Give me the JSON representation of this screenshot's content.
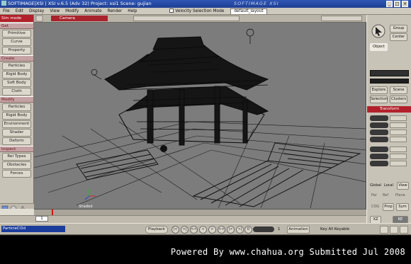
{
  "window": {
    "title": "SOFTIMAGE|XSI | XSI v.6.5 (Adv 32) Project: xsi1   Scene: gujian",
    "watermark": "SOFTIMAGE XSI",
    "controls": [
      "_",
      "□",
      "×"
    ]
  },
  "menubar": {
    "items": [
      "File",
      "Edit",
      "Display",
      "View",
      "Modify",
      "Animate",
      "Render",
      "Help"
    ],
    "checkbox_label": "Velocity Selection Mode",
    "dropdown_value": "default_layout"
  },
  "toolbar": {
    "title": "Sim mode",
    "sections": [
      {
        "label": "Get",
        "buttons": [
          "Primitive",
          "Curve",
          "Property"
        ]
      },
      {
        "label": "Create",
        "buttons": [
          "Particles",
          "Rigid Body",
          "Soft Body",
          "Cloth"
        ]
      },
      {
        "label": "Modify",
        "buttons": [
          "Particles",
          "Rigid Body",
          "Environment",
          "Shader",
          "Deform"
        ]
      },
      {
        "label": "Inspect",
        "buttons": [
          "Rel Types",
          "Obstacles",
          "Forces"
        ]
      }
    ]
  },
  "viewport": {
    "camera_label": "Camera",
    "coordinate_label": "Shaded",
    "background": "#7c7c7c"
  },
  "right_panel": {
    "group_button": "Group",
    "center_button": "Center",
    "object_field": "Object",
    "explore_button": "Explore",
    "scene_button": "Scene",
    "selection_button": "Selection",
    "cluster_button": "Clusters",
    "transform_header": "Transform",
    "global_label": "Global",
    "local_label": "Local",
    "view_label": "View",
    "par_label": "Par",
    "ref_label": "Ref",
    "plane_label": "Plane",
    "cog_label": "COG",
    "prop_label": "Prop",
    "sym_label": "Sym",
    "mode_value": "XZ",
    "keyframe_label": "KE"
  },
  "status": {
    "frame_value": "1"
  },
  "playbar": {
    "selection_value": "ParticleCl3d",
    "playback_label": "Playback",
    "frame_field": "1",
    "animation_label": "Animation",
    "key_check": "Key All Keyable",
    "transport": [
      "|<",
      "<|",
      "<<",
      "<",
      ">",
      ">>",
      "|>",
      ">|",
      "O"
    ]
  },
  "footer": {
    "credit": "Powered By www.chahua.org  Submitted Jul 2008"
  },
  "colors": {
    "toolbar_header": "#b2212b",
    "section_bg": "#c5a3a5",
    "panel_bg": "#c8c3b7",
    "selection_blue": "#1b3c9b"
  }
}
